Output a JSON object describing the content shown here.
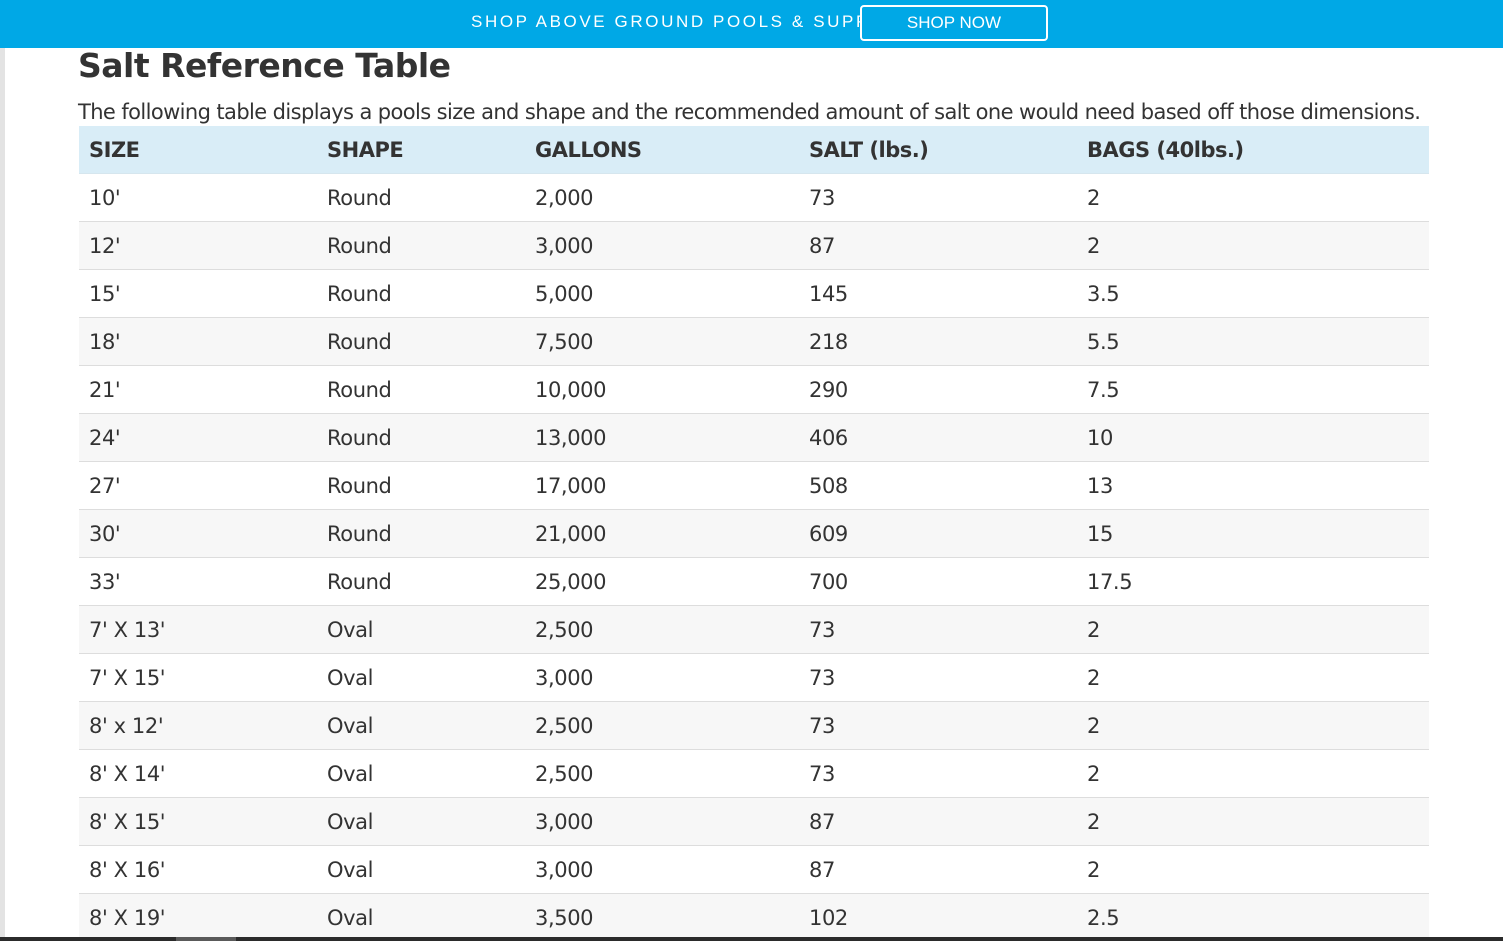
{
  "promo": {
    "text": "SHOP ABOVE GROUND POOLS & SUPPLIES",
    "button_label": "SHOP NOW"
  },
  "colors": {
    "promo_bar": "#00a8e6",
    "table_header_bg": "#d9edf7",
    "text": "#333333"
  },
  "page": {
    "title": "Salt Reference Table",
    "description": "The following table displays a pools size and shape and the recommended amount of salt one would need based off those dimensions."
  },
  "table": {
    "headers": [
      "SIZE",
      "SHAPE",
      "GALLONS",
      "SALT (lbs.)",
      "BAGS (40lbs.)"
    ],
    "rows": [
      [
        "10'",
        "Round",
        "2,000",
        "73",
        "2"
      ],
      [
        "12'",
        "Round",
        "3,000",
        "87",
        "2"
      ],
      [
        "15'",
        "Round",
        "5,000",
        "145",
        "3.5"
      ],
      [
        "18'",
        "Round",
        "7,500",
        "218",
        "5.5"
      ],
      [
        "21'",
        "Round",
        "10,000",
        "290",
        "7.5"
      ],
      [
        "24'",
        "Round",
        "13,000",
        "406",
        "10"
      ],
      [
        "27'",
        "Round",
        "17,000",
        "508",
        "13"
      ],
      [
        "30'",
        "Round",
        "21,000",
        "609",
        "15"
      ],
      [
        "33'",
        "Round",
        "25,000",
        "700",
        "17.5"
      ],
      [
        "7' X 13'",
        "Oval",
        "2,500",
        "73",
        "2"
      ],
      [
        "7' X 15'",
        "Oval",
        "3,000",
        "73",
        "2"
      ],
      [
        "8' x 12'",
        "Oval",
        "2,500",
        "73",
        "2"
      ],
      [
        "8' X 14'",
        "Oval",
        "2,500",
        "73",
        "2"
      ],
      [
        "8' X 15'",
        "Oval",
        "3,000",
        "87",
        "2"
      ],
      [
        "8' X 16'",
        "Oval",
        "3,000",
        "87",
        "2"
      ],
      [
        "8' X 19'",
        "Oval",
        "3,500",
        "102",
        "2.5"
      ]
    ]
  }
}
